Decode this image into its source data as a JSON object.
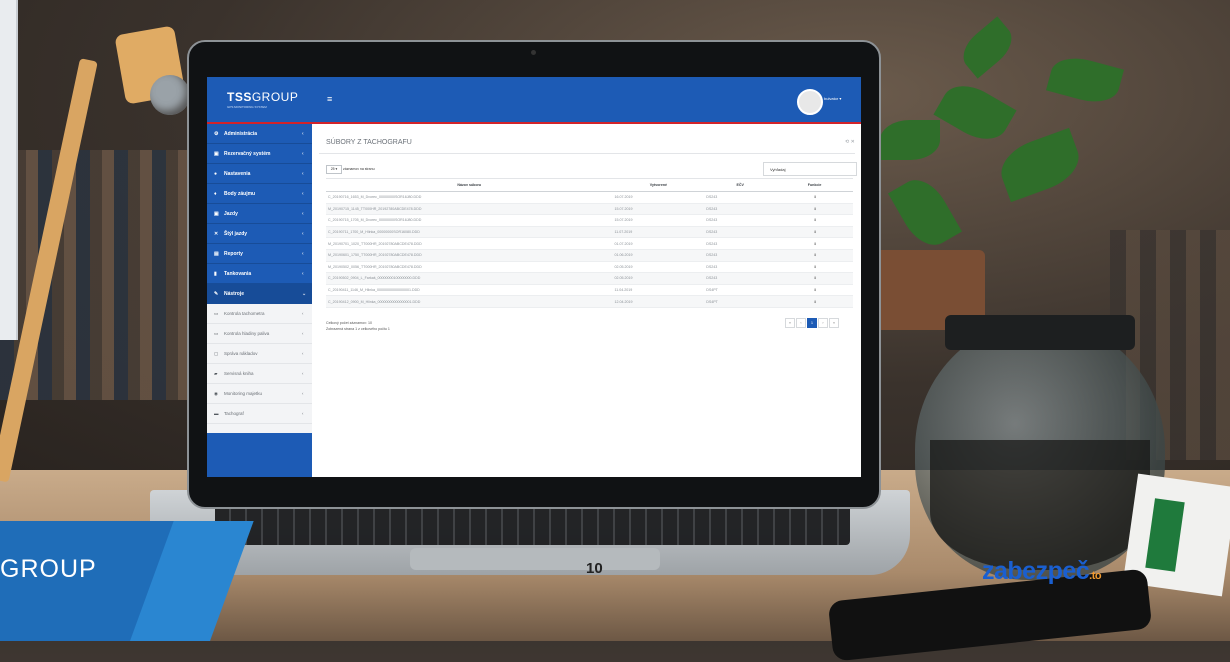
{
  "app": {
    "brand_bold": "TSS",
    "brand_light": "GROUP",
    "brand_sub": "GPS MONITORING SYSTEM",
    "menu_icon": "hamburger-icon",
    "user_name": "bulvator ▾"
  },
  "sidebar": {
    "items": [
      {
        "label": "Administrácia",
        "icon": "cogs-icon"
      },
      {
        "label": "Rezervačný systém",
        "icon": "car-icon"
      },
      {
        "label": "Nastavenia",
        "icon": "gear-icon"
      },
      {
        "label": "Body záujmu",
        "icon": "pin-icon"
      },
      {
        "label": "Jazdy",
        "icon": "car-icon"
      },
      {
        "label": "Štýl jazdy",
        "icon": "shuffle-icon"
      },
      {
        "label": "Reporty",
        "icon": "document-icon"
      },
      {
        "label": "Tankovania",
        "icon": "fuel-icon"
      },
      {
        "label": "Nástroje",
        "icon": "wrench-icon"
      }
    ],
    "subitems": [
      {
        "label": "Kontrola tachometra",
        "icon": "gauge-icon"
      },
      {
        "label": "Kontrola hladiny paliva",
        "icon": "gauge-icon"
      },
      {
        "label": "Správa nákladov",
        "icon": "money-icon"
      },
      {
        "label": "Servisná kniha",
        "icon": "book-icon"
      },
      {
        "label": "Monitoring majetku",
        "icon": "globe-icon"
      },
      {
        "label": "Tachograf",
        "icon": "truck-icon"
      }
    ]
  },
  "page": {
    "title": "SÚBORY Z TACHOGRAFU",
    "page_size": "25 ▾",
    "page_size_label": "záznamov na stranu",
    "search_label": "Vyhľadaj",
    "columns": [
      "Názov súboru",
      "Vytvorené",
      "EČV",
      "Funkcie"
    ],
    "rows": [
      [
        "C_20190716_1653_M_Dvorec_00000000SOR16J80.DDD",
        "16.07.2019",
        "DS243",
        "⬇"
      ],
      [
        "M_20190715_1145_TT000HR_20192780ABCDE478.DDD",
        "15.07.2019",
        "DS243",
        "⬇"
      ],
      [
        "C_20190715_1705_M_Dvorec_00000000SOR16J80.DDD",
        "15.07.2019",
        "DS243",
        "⬇"
      ],
      [
        "C_20190711_1700_M_Hlinka_00000000SOR16080.DDD",
        "11.07.2019",
        "DS243",
        "⬇"
      ],
      [
        "M_20190701_1020_TT000HR_20192780ABCDE478.DDD",
        "01.07.2019",
        "DS243",
        "⬇"
      ],
      [
        "M_20190601_1750_TT000HR_20192780ABCDE478.DDD",
        "01.06.2019",
        "DS243",
        "⬇"
      ],
      [
        "M_20190502_0056_TT000HR_20192780ABCDE478.DDD",
        "02.05.2019",
        "DS243",
        "⬇"
      ],
      [
        "C_20190502_0904_L_Farkaš_00000000100000000.DDD",
        "02.05.2019",
        "DS243",
        "⬇"
      ],
      [
        "C_20190411_1146_M_Hlinka_00000000000000001.DDD",
        "11.04.2019",
        "DS4PT",
        "⬇"
      ],
      [
        "C_20190412_0900_M_Hlinka_00000000000000001.DDD",
        "12.04.2019",
        "DS4PT",
        "⬇"
      ]
    ],
    "total_label": "Celkový počet záznamov: 10",
    "showing_label": "Zobrazená strana 1 z celkového počtu 1",
    "pager": [
      "«",
      "‹",
      "1",
      "›",
      "»"
    ]
  },
  "slide": {
    "brand": "GROUP",
    "page_number": "10",
    "logo_main": "zabezpeč",
    "logo_tld": ".to"
  },
  "colors": {
    "primary": "#1d5bb5",
    "accent_red": "#d2232a",
    "slide_blue": "#1f6db8"
  }
}
